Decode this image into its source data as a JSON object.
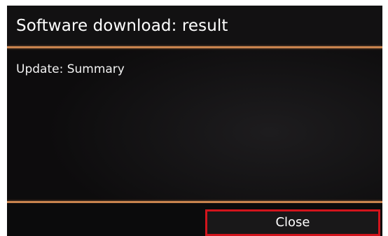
{
  "header": {
    "title": "Software download: result"
  },
  "main": {
    "section_label": "Update: Summary"
  },
  "footer": {
    "close_label": "Close"
  },
  "colors": {
    "background": "#0d0c0d",
    "divider": "#c8834e",
    "button_border": "#d2141c",
    "text": "#ffffff"
  }
}
